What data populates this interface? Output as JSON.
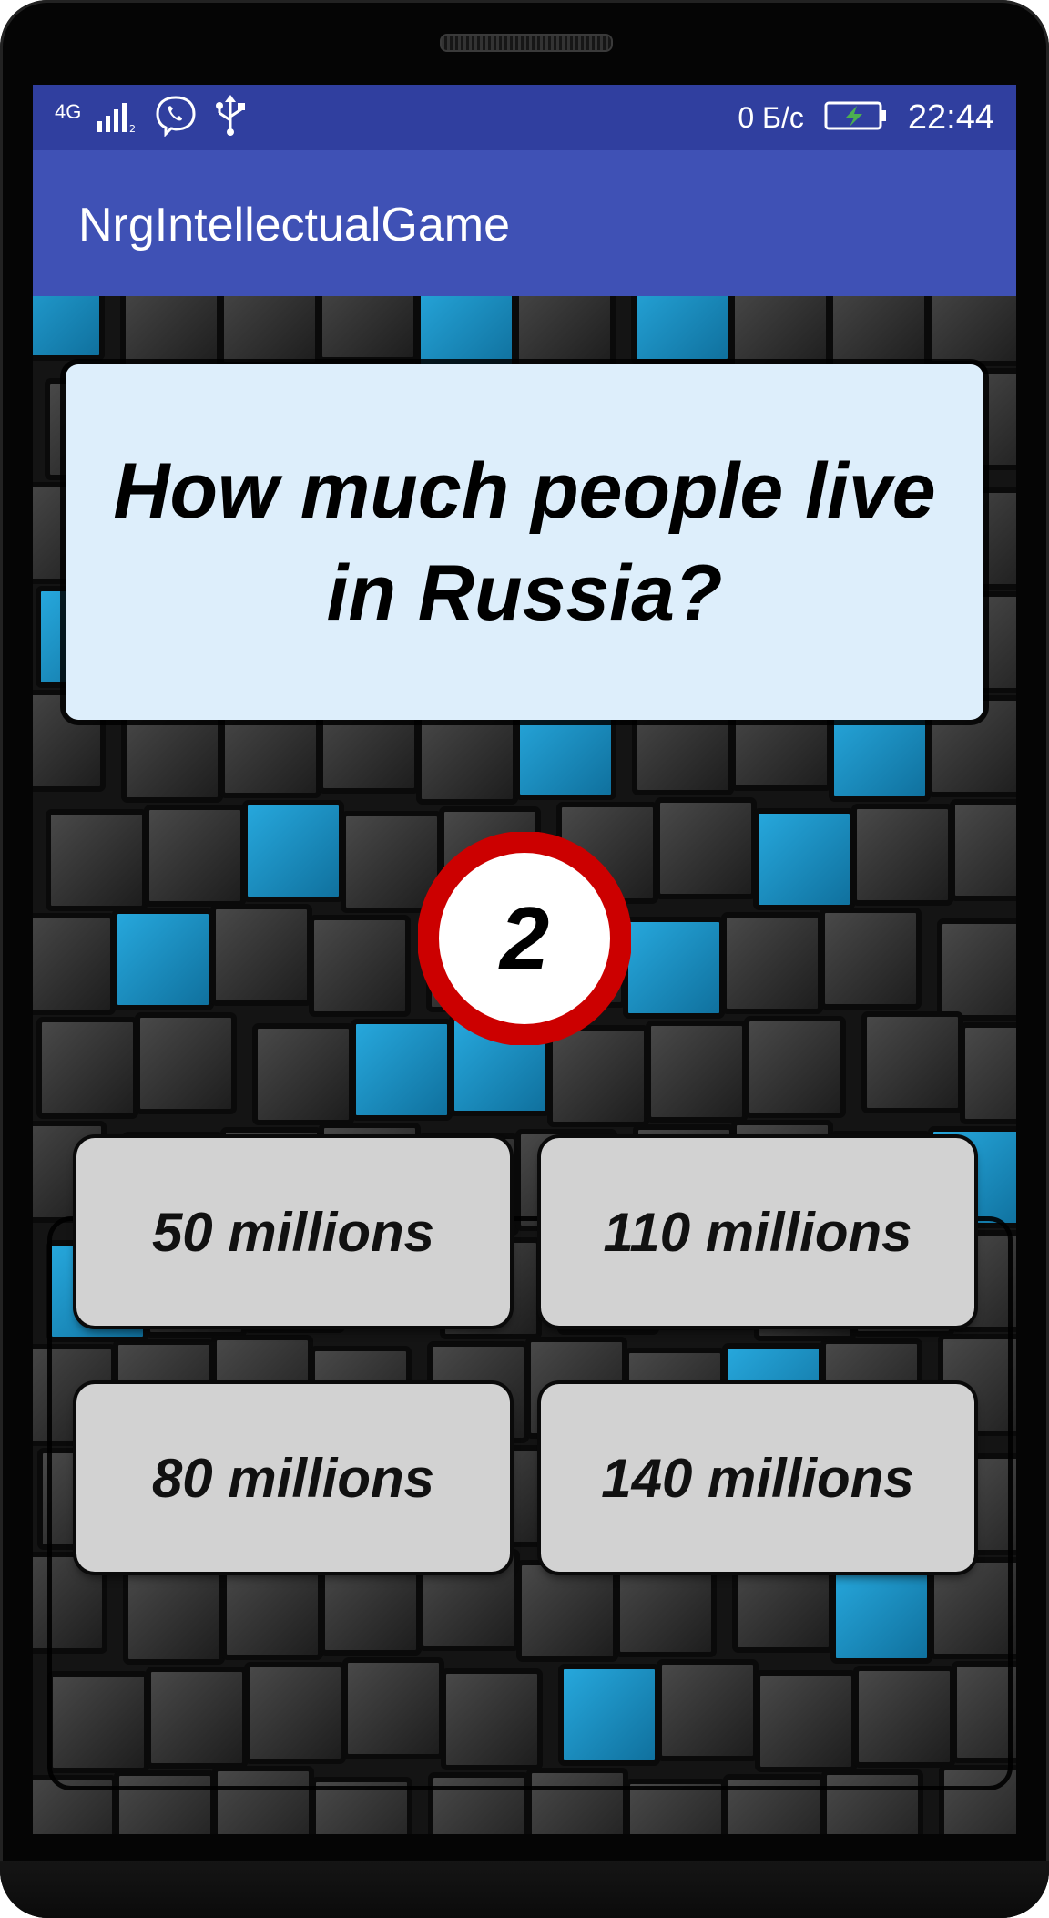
{
  "status_bar": {
    "network_type": "4G",
    "speed": "0 Б/с",
    "time": "22:44"
  },
  "app_bar": {
    "title": "NrgIntellectualGame"
  },
  "question": {
    "text": "How much people live in Russia?"
  },
  "timer": {
    "value": "2"
  },
  "answers": [
    {
      "label": "50 millions"
    },
    {
      "label": "110 millions"
    },
    {
      "label": "80 millions"
    },
    {
      "label": "140 millions"
    }
  ],
  "colors": {
    "status_bar": "#303f9f",
    "app_bar": "#3f51b5",
    "question_card": "#ddeefb",
    "timer_ring": "#cc0000",
    "answer_button": "#d2d2d2",
    "cube_accent": "#1a8fc3"
  },
  "icons": [
    "signal-icon",
    "viber-icon",
    "usb-icon",
    "battery-charging-icon"
  ]
}
